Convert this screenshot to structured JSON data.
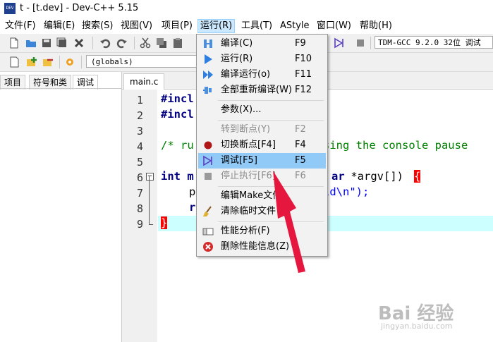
{
  "window": {
    "title": "t - [t.dev] - Dev-C++ 5.15",
    "app_icon_text": "DEV"
  },
  "menubar": [
    {
      "label": "文件(F)"
    },
    {
      "label": "编辑(E)"
    },
    {
      "label": "搜索(S)"
    },
    {
      "label": "视图(V)"
    },
    {
      "label": "项目(P)"
    },
    {
      "label": "运行(R)"
    },
    {
      "label": "工具(T)"
    },
    {
      "label": "AStyle"
    },
    {
      "label": "窗口(W)"
    },
    {
      "label": "帮助(H)"
    }
  ],
  "toolbar": {
    "compiler": "TDM-GCC 9.2.0 32位 调试",
    "scope": "(globals)"
  },
  "left_panel": {
    "tabs": [
      "项目",
      "符号和类",
      "调试"
    ],
    "active_tab": "调试"
  },
  "editor": {
    "tab": "main.c",
    "line_numbers": [
      "1",
      "2",
      "3",
      "4",
      "5",
      "6",
      "7",
      "8",
      "9"
    ],
    "lines": [
      "#incl",
      "#incl",
      "",
      "/* ru",
      "int m",
      "p",
      "r",
      "}"
    ],
    "line4_tail": "sing the console pause",
    "line6_tail_kw": "ar",
    "line6_tail_rest": " *argv[]) ",
    "line6_brace": "{",
    "line7_tail": "ld\\n\");"
  },
  "run_menu": {
    "items": [
      {
        "label": "编译(C)",
        "key": "F9",
        "icon": "compile-icon",
        "disabled": false
      },
      {
        "label": "运行(R)",
        "key": "F10",
        "icon": "run-icon",
        "disabled": false
      },
      {
        "label": "编译运行(o)",
        "key": "F11",
        "icon": "compile-run-icon",
        "disabled": false
      },
      {
        "label": "全部重新编译(W)",
        "key": "F12",
        "icon": "rebuild-icon",
        "disabled": false
      },
      {
        "label": "参数(X)...",
        "key": "",
        "icon": "",
        "disabled": false
      },
      {
        "label": "转到断点(Y)",
        "key": "F2",
        "icon": "",
        "disabled": true
      },
      {
        "label": "切换断点[F4]",
        "key": "F4",
        "icon": "breakpoint-icon",
        "disabled": false
      },
      {
        "label": "调试[F5]",
        "key": "F5",
        "icon": "debug-icon",
        "disabled": false,
        "selected": true
      },
      {
        "label": "停止执行[F6]",
        "key": "F6",
        "icon": "stop-icon",
        "disabled": true
      },
      {
        "label": "编辑Make文件",
        "key": "",
        "icon": "",
        "disabled": false
      },
      {
        "label": "清除临时文件",
        "key": "",
        "icon": "broom-icon",
        "disabled": false
      },
      {
        "label": "性能分析(F)",
        "key": "",
        "icon": "profile-icon",
        "disabled": false
      },
      {
        "label": "删除性能信息(Z)",
        "key": "",
        "icon": "delete-profile-icon",
        "disabled": false
      }
    ]
  },
  "watermark": {
    "brand": "Bai 经验",
    "url": "jingyan.baidu.com"
  },
  "colors": {
    "selected": "#91c9f7",
    "arrow": "#e5173f",
    "current_line": "#ccffff"
  }
}
